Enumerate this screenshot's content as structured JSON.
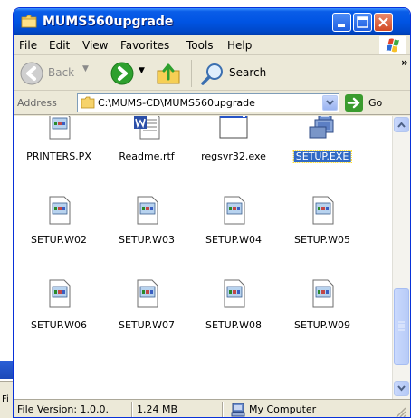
{
  "window": {
    "title": "MUMS560upgrade"
  },
  "menu": {
    "items": [
      {
        "label": "File",
        "icon": "none"
      },
      {
        "label": "Edit"
      },
      {
        "label": "View"
      },
      {
        "label": "Favorites"
      },
      {
        "label": "Tools"
      },
      {
        "label": "Help"
      }
    ]
  },
  "toolbar": {
    "back_label": "Back",
    "search_label": "Search",
    "overflow_label": "»"
  },
  "address": {
    "label": "Address",
    "path": "C:\\MUMS-CD\\MUMS560upgrade",
    "go_label": "Go"
  },
  "files": [
    {
      "name": "PRINTERS.PX",
      "icon": "generic-file-icon",
      "selected": false
    },
    {
      "name": "Readme.rtf",
      "icon": "word-document-icon",
      "selected": false
    },
    {
      "name": "regsvr32.exe",
      "icon": "application-window-icon",
      "selected": false
    },
    {
      "name": "SETUP.EXE",
      "icon": "setup-installer-icon",
      "selected": true
    },
    {
      "name": "SETUP.W02",
      "icon": "generic-file-icon",
      "selected": false
    },
    {
      "name": "SETUP.W03",
      "icon": "generic-file-icon",
      "selected": false
    },
    {
      "name": "SETUP.W04",
      "icon": "generic-file-icon",
      "selected": false
    },
    {
      "name": "SETUP.W05",
      "icon": "generic-file-icon",
      "selected": false
    },
    {
      "name": "SETUP.W06",
      "icon": "generic-file-icon",
      "selected": false
    },
    {
      "name": "SETUP.W07",
      "icon": "generic-file-icon",
      "selected": false
    },
    {
      "name": "SETUP.W08",
      "icon": "generic-file-icon",
      "selected": false
    },
    {
      "name": "SETUP.W09",
      "icon": "generic-file-icon",
      "selected": false
    }
  ],
  "status": {
    "version": "File Version: 1.0.0.",
    "size": "1.24 MB",
    "location": "My Computer"
  },
  "background": {
    "partial_label": "Fi"
  },
  "colors": {
    "titlebar": "#0054e3",
    "selection": "#316ac5",
    "chrome": "#ece9d8"
  }
}
